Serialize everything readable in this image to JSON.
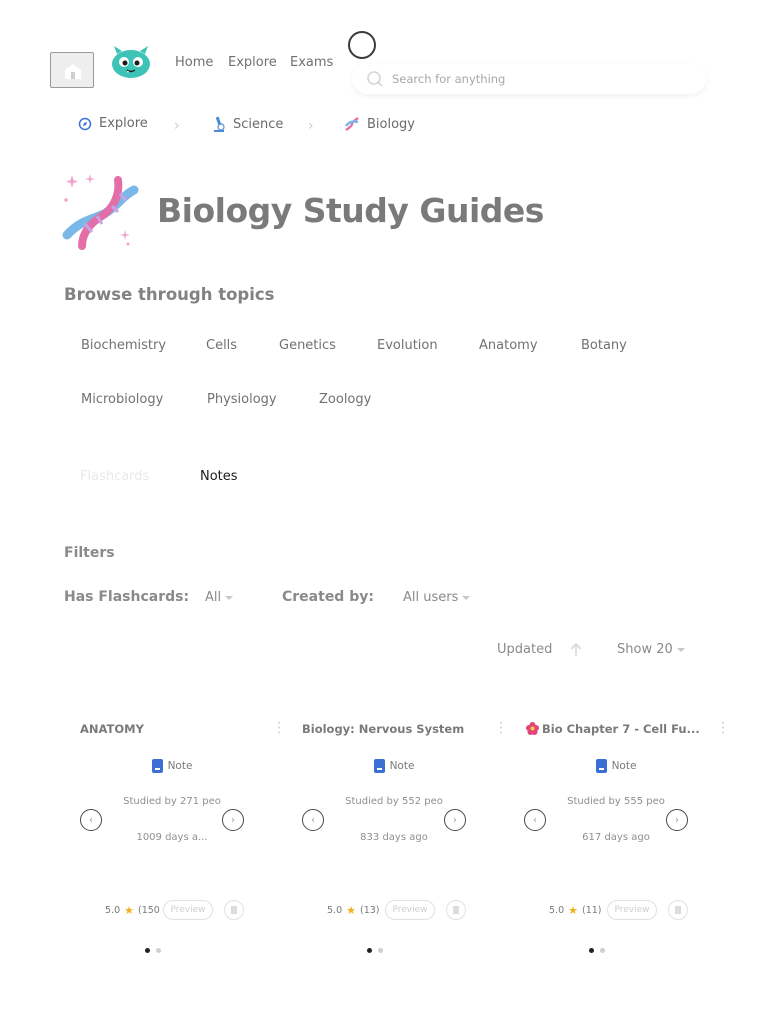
{
  "header": {
    "nav": [
      "Home",
      "Explore",
      "Exams"
    ],
    "search_placeholder": "Search for anything"
  },
  "breadcrumb": [
    {
      "label": "Explore",
      "icon": "compass-icon"
    },
    {
      "label": "Science",
      "icon": "microscope-icon"
    },
    {
      "label": "Biology",
      "icon": "dna-icon"
    }
  ],
  "page": {
    "title": "Biology Study Guides",
    "browse_title": "Browse through topics",
    "topics": [
      "Biochemistry",
      "Cells",
      "Genetics",
      "Evolution",
      "Anatomy",
      "Botany",
      "Microbiology",
      "Physiology",
      "Zoology"
    ]
  },
  "tabs": [
    {
      "label": "Flashcards",
      "active": false
    },
    {
      "label": "Notes",
      "active": true
    }
  ],
  "filters": {
    "title": "Filters",
    "has_flashcards_label": "Has Flashcards:",
    "has_flashcards_value": "All",
    "created_by_label": "Created by:",
    "created_by_value": "All users"
  },
  "sort": {
    "updated_label": "Updated",
    "show_label": "Show 20"
  },
  "cards": [
    {
      "title": "ANATOMY",
      "type": "Note",
      "studied": "Studied by 271 peo",
      "ago": "1009 days a...",
      "rating": "5.0",
      "rating_count": "(150",
      "preview": "Preview",
      "has_flower": false
    },
    {
      "title": "Biology: Nervous System",
      "type": "Note",
      "studied": "Studied by 552 peo",
      "ago": "833 days ago",
      "rating": "5.0",
      "rating_count": "(13)",
      "preview": "Preview",
      "has_flower": false
    },
    {
      "title": "Bio Chapter 7 - Cell Fu...",
      "type": "Note",
      "studied": "Studied by 555 peo",
      "ago": "617 days ago",
      "rating": "5.0",
      "rating_count": "(11)",
      "preview": "Preview",
      "has_flower": true
    }
  ],
  "colors": {
    "accent_blue": "#3b6fd6",
    "star": "#f3b01c",
    "mascot": "#3ec4b6"
  }
}
